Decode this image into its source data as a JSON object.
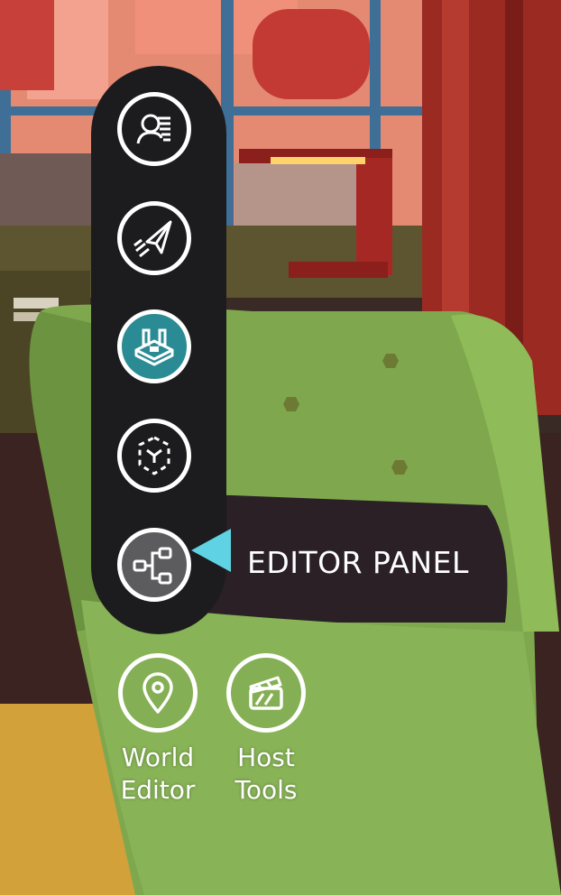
{
  "toolbar": {
    "tools": [
      {
        "name": "avatar-tool",
        "icon": "person-list-icon",
        "state": "default"
      },
      {
        "name": "send-tool",
        "icon": "paper-plane-icon",
        "state": "default"
      },
      {
        "name": "build-tool",
        "icon": "room-build-icon",
        "state": "active"
      },
      {
        "name": "object-tool",
        "icon": "cube-bounds-icon",
        "state": "default"
      },
      {
        "name": "editor-panel-tool",
        "icon": "node-graph-icon",
        "state": "hovered"
      }
    ]
  },
  "tooltip": {
    "label": "EDITOR PANEL",
    "color": "#5fd3e3"
  },
  "bottom_tools": [
    {
      "icon": "map-pin-icon",
      "label_line1": "World",
      "label_line2": "Editor"
    },
    {
      "icon": "clapperboard-icon",
      "label_line1": "Host",
      "label_line2": "Tools"
    }
  ],
  "colors": {
    "toolbar_bg": "#1c1c1e",
    "active_button": "#2a8b94",
    "hover_button": "#5c5c5e",
    "chair_green": "#7fa84e",
    "pillow": "#2a2026"
  }
}
